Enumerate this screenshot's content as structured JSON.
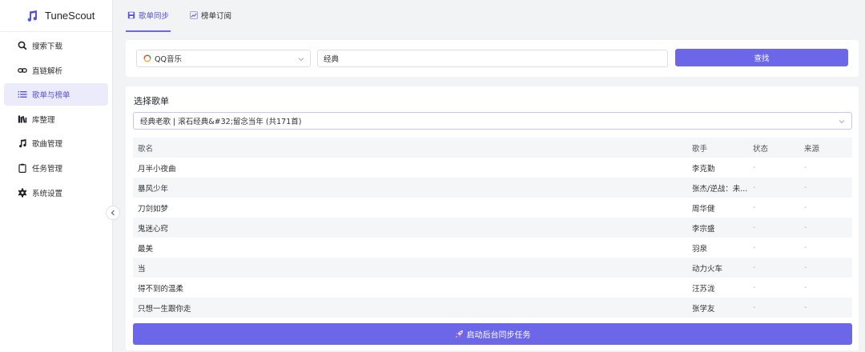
{
  "app": {
    "name": "TuneScout"
  },
  "sidebar": {
    "items": [
      {
        "label": "搜索下载",
        "icon": "search-icon",
        "active": false
      },
      {
        "label": "直链解析",
        "icon": "link-icon",
        "active": false
      },
      {
        "label": "歌单与榜单",
        "icon": "list-icon",
        "active": true
      },
      {
        "label": "库整理",
        "icon": "library-icon",
        "active": false
      },
      {
        "label": "歌曲管理",
        "icon": "music-note-icon",
        "active": false
      },
      {
        "label": "任务管理",
        "icon": "clipboard-icon",
        "active": false
      },
      {
        "label": "系统设置",
        "icon": "gear-icon",
        "active": false
      }
    ]
  },
  "tabs": [
    {
      "label": "歌单同步",
      "icon": "save-icon",
      "active": true
    },
    {
      "label": "榜单订阅",
      "icon": "chart-icon",
      "active": false
    }
  ],
  "search": {
    "source": "QQ音乐",
    "keyword": "经典",
    "button_label": "查找"
  },
  "playlist": {
    "section_title": "选择歌单",
    "selected": "经典老歌 | 滚石经典&#32;留念当年 (共171首)"
  },
  "table": {
    "columns": [
      "歌名",
      "歌手",
      "状态",
      "来源"
    ],
    "rows": [
      {
        "title": "月半小夜曲",
        "artist": "李克勤",
        "status": "-",
        "source": "-"
      },
      {
        "title": "暴风少年",
        "artist": "张杰/逆战：未...",
        "status": "-",
        "source": "-"
      },
      {
        "title": "刀剑如梦",
        "artist": "周华健",
        "status": "-",
        "source": "-"
      },
      {
        "title": "鬼迷心窍",
        "artist": "李宗盛",
        "status": "-",
        "source": "-"
      },
      {
        "title": "最美",
        "artist": "羽泉",
        "status": "-",
        "source": "-"
      },
      {
        "title": "当",
        "artist": "动力火车",
        "status": "-",
        "source": "-"
      },
      {
        "title": "得不到的温柔",
        "artist": "汪苏泷",
        "status": "-",
        "source": "-"
      },
      {
        "title": "只想一生跟你走",
        "artist": "张学友",
        "status": "-",
        "source": "-"
      }
    ]
  },
  "sync_button_label": "启动后台同步任务",
  "colors": {
    "accent": "#6c67e8",
    "active_bg": "#ecebfb",
    "background": "#f2f3f5"
  }
}
